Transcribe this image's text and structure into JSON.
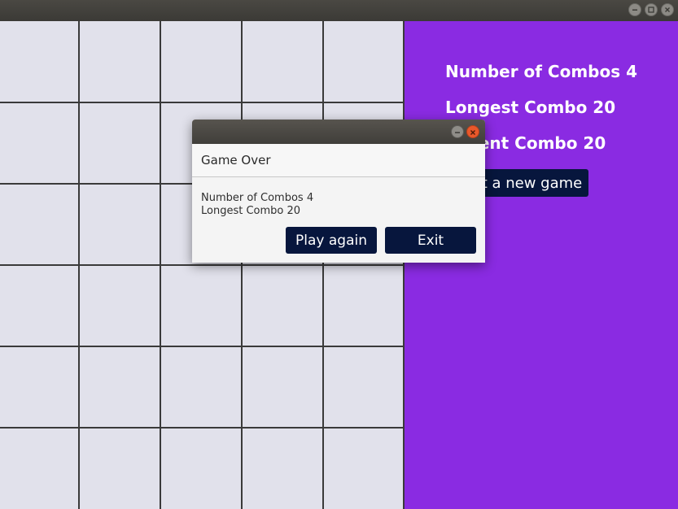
{
  "window": {
    "buttons": [
      "minimize-icon",
      "maximize-icon",
      "close-icon"
    ]
  },
  "board": {
    "columns": 5,
    "rows": 6,
    "cell_color": "#e1e1eb",
    "line_color": "#3a3a3a"
  },
  "side_panel": {
    "background": "#8a2be2",
    "stat_combos": "Number of Combos 4",
    "stat_longest": "Longest Combo 20",
    "stat_recent": "Recent Combo 20",
    "new_game_label": "Start a new game"
  },
  "dialog": {
    "header": "Game Over",
    "line1": "Number of Combos 4",
    "line2": "Longest Combo 20",
    "play_again_label": "Play again",
    "exit_label": "Exit",
    "buttons_color": "#07163d",
    "titlebar_icons": [
      "minimize-icon",
      "close-icon"
    ]
  }
}
